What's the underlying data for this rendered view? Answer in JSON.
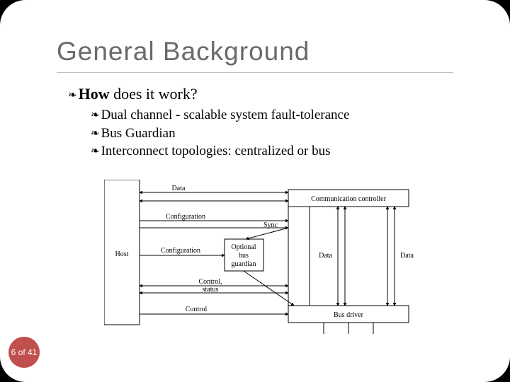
{
  "title": "General Background",
  "heading": {
    "sym": "❧",
    "bold": "How",
    "rest": " does it work?"
  },
  "bullets": [
    "Dual channel - scalable system fault-tolerance",
    "Bus Guardian",
    "Interconnect topologies: centralized or bus"
  ],
  "sym": "❧",
  "page": "6 of 41",
  "diagram": {
    "host": "Host",
    "data1": "Data",
    "config": "Configuration",
    "control": "Control",
    "config2": "Configuration",
    "comm": "Communication controller",
    "sync": "Sync",
    "optional1": "Optional",
    "optional2": "bus",
    "optional3": "guardian",
    "data2": "Data",
    "data3": "Data",
    "ctrlstat1": "Control,",
    "ctrlstat2": "status",
    "busdrv": "Bus driver"
  }
}
